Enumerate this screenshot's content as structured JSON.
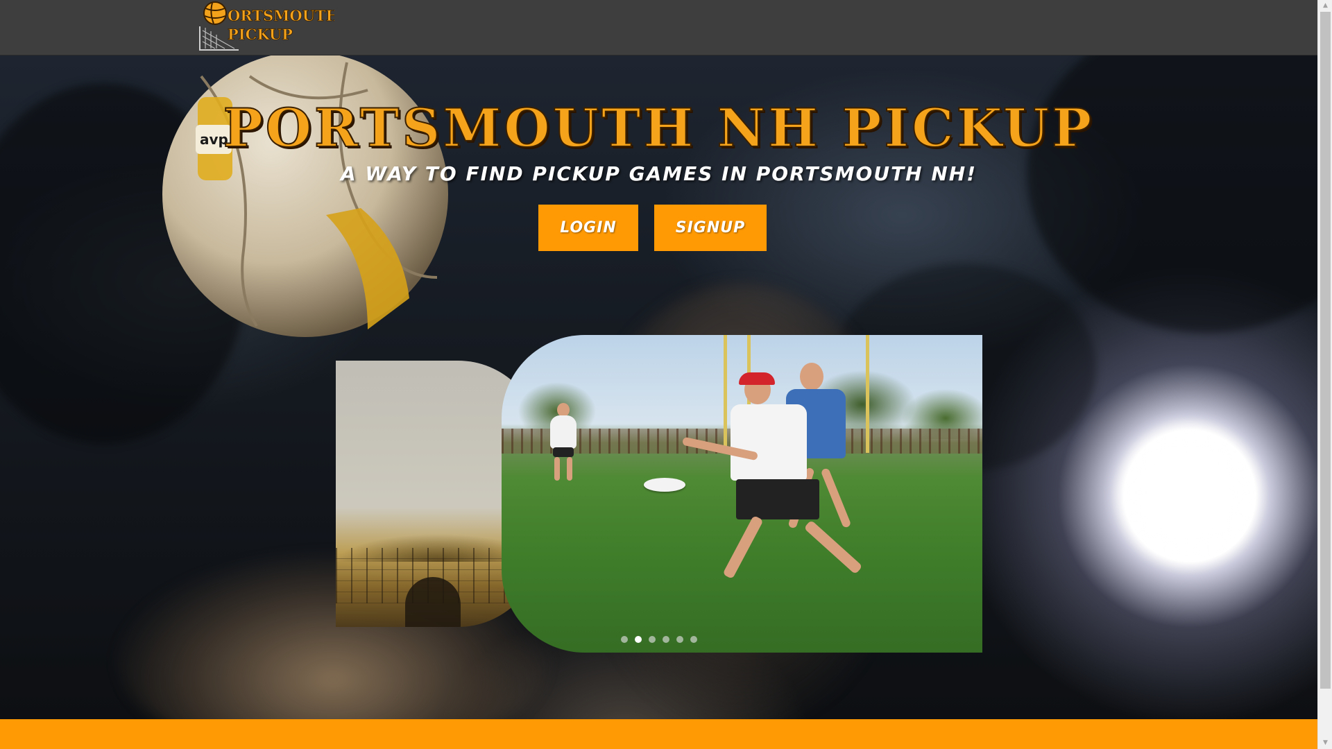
{
  "header": {
    "logo_line1": "ORTSMOUTH",
    "logo_line2": "PICKUP",
    "logo_icon": "volleyball-icon"
  },
  "hero": {
    "title": "Portsmouth NH Pickup",
    "subtitle": "A way to find pickup games in Portsmouth NH!",
    "buttons": {
      "login": "Login",
      "signup": "Signup"
    }
  },
  "carousel": {
    "slide_count": 6,
    "active_index": 1
  },
  "colors": {
    "accent": "#ff9a04",
    "title": "#f5a31a",
    "navbar": "#3e3e3e"
  },
  "scrollbar": {
    "up_icon": "triangle-up-icon",
    "down_icon": "triangle-down-icon"
  }
}
